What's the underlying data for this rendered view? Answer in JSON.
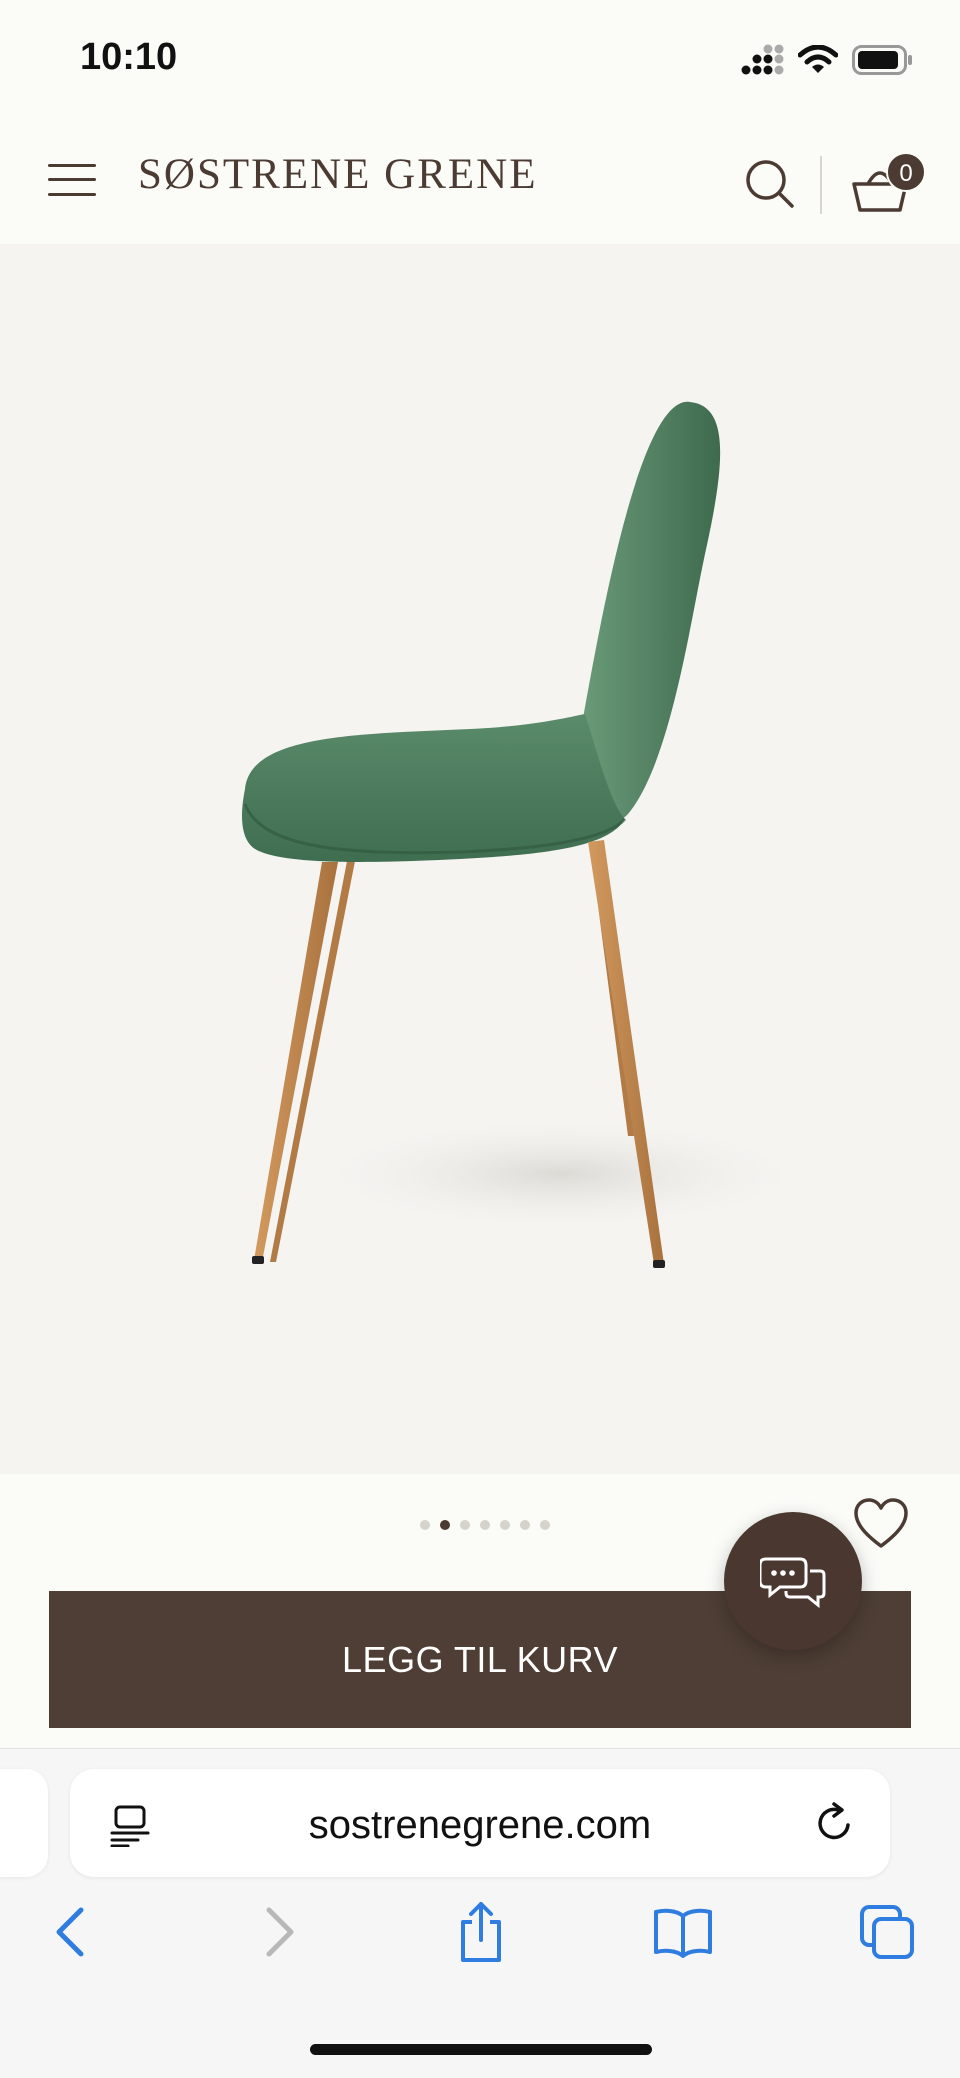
{
  "status_bar": {
    "time": "10:10",
    "icons": [
      "signal-icon",
      "wifi-icon",
      "battery-icon"
    ]
  },
  "header": {
    "menu_icon": "hamburger-menu-icon",
    "logo_text": "SØSTRENE GRENE",
    "search_icon": "search-icon",
    "cart_icon": "basket-icon",
    "cart_count": "0"
  },
  "product": {
    "image_description_icon": "green-velvet-dining-chair-image",
    "carousel": {
      "total": 7,
      "active_index": 1
    },
    "wishlist_icon": "heart-icon",
    "add_to_cart_label": "LEGG TIL KURV",
    "chat_icon": "chat-bubbles-icon"
  },
  "browser": {
    "url": "sostrenegrene.com",
    "page_menu_icon": "page-menu-icon",
    "reload_icon": "reload-icon",
    "toolbar": [
      "back-icon",
      "forward-icon",
      "share-icon",
      "bookmarks-icon",
      "tabs-icon"
    ]
  },
  "colors": {
    "brand_brown": "#4e3e35",
    "chair_green": "#4f8060",
    "wood": "#c08a52",
    "browser_blue": "#2f7de1"
  }
}
